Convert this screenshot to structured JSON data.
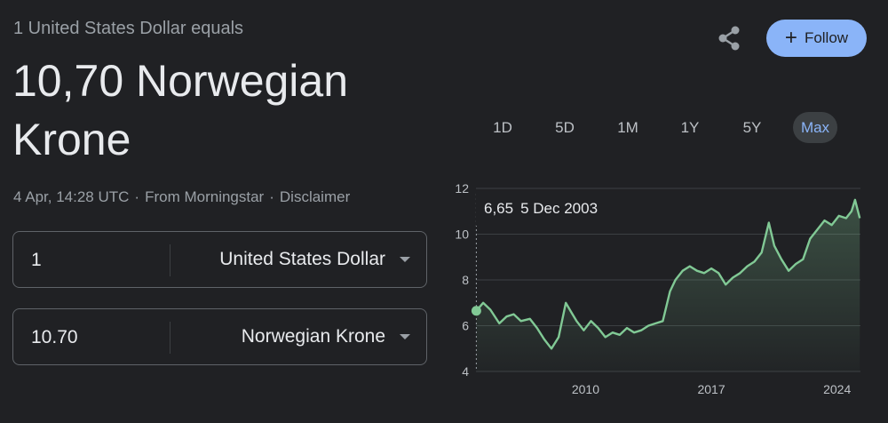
{
  "header": {
    "subtitle": "1 United States Dollar equals",
    "rate_line": "10,70 Norwegian Krone"
  },
  "meta": {
    "timestamp": "4 Apr, 14:28 UTC",
    "source": "From Morningstar",
    "disclaimer": "Disclaimer"
  },
  "converter": {
    "from_amount": "1",
    "from_currency": "United States Dollar",
    "to_amount": "10.70",
    "to_currency": "Norwegian Krone"
  },
  "actions": {
    "share_icon": "share-icon",
    "follow_label": "Follow",
    "follow_icon": "plus-icon"
  },
  "ranges": [
    "1D",
    "5D",
    "1M",
    "1Y",
    "5Y",
    "Max"
  ],
  "active_range": "Max",
  "tooltip": {
    "value": "6,65",
    "date": "5 Dec 2003"
  },
  "chart_data": {
    "type": "area",
    "title": "",
    "xlabel": "",
    "ylabel": "",
    "x_ticks": [
      "2010",
      "2017",
      "2024"
    ],
    "y_ticks": [
      "12",
      "10",
      "8",
      "6",
      "4"
    ],
    "ylim": [
      4,
      12
    ],
    "xlim": [
      2003.9,
      2025.3
    ],
    "grid": true,
    "line_color": "#81c995",
    "series": [
      {
        "name": "",
        "x": [
          2003.92,
          2004.3,
          2004.7,
          2005.2,
          2005.6,
          2006.0,
          2006.4,
          2006.9,
          2007.3,
          2007.7,
          2008.1,
          2008.5,
          2008.9,
          2009.2,
          2009.5,
          2009.9,
          2010.3,
          2010.7,
          2011.1,
          2011.5,
          2011.9,
          2012.3,
          2012.7,
          2013.1,
          2013.5,
          2013.9,
          2014.3,
          2014.7,
          2015.0,
          2015.4,
          2015.8,
          2016.2,
          2016.6,
          2017.0,
          2017.4,
          2017.8,
          2018.2,
          2018.6,
          2019.0,
          2019.4,
          2019.8,
          2020.2,
          2020.5,
          2020.9,
          2021.3,
          2021.7,
          2022.1,
          2022.5,
          2022.9,
          2023.3,
          2023.7,
          2024.1,
          2024.5,
          2024.8,
          2025.0,
          2025.26
        ],
        "values": [
          6.65,
          7.0,
          6.7,
          6.1,
          6.4,
          6.5,
          6.2,
          6.3,
          5.9,
          5.4,
          5.0,
          5.5,
          7.0,
          6.6,
          6.2,
          5.8,
          6.2,
          5.9,
          5.5,
          5.7,
          5.6,
          5.9,
          5.7,
          5.8,
          6.0,
          6.1,
          6.2,
          7.5,
          8.0,
          8.4,
          8.6,
          8.4,
          8.3,
          8.5,
          8.3,
          7.8,
          8.1,
          8.3,
          8.6,
          8.8,
          9.2,
          10.5,
          9.5,
          8.9,
          8.4,
          8.7,
          8.9,
          9.8,
          10.2,
          10.6,
          10.4,
          10.8,
          10.7,
          11.0,
          11.5,
          10.7
        ]
      }
    ]
  }
}
